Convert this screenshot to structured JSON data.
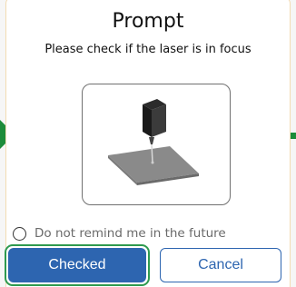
{
  "dialog": {
    "title": "Prompt",
    "message": "Please check if the laser is in focus",
    "illustration_icon": "laser-focus-illustration",
    "remind_label": "Do not remind me in the future",
    "remind_checked": false,
    "confirm_label": "Checked",
    "cancel_label": "Cancel"
  },
  "colors": {
    "primary": "#2d65b0",
    "focus_ring": "#2e9a4f",
    "background_arrow": "#1c8c3a",
    "dialog_border": "#f3dcb3"
  }
}
